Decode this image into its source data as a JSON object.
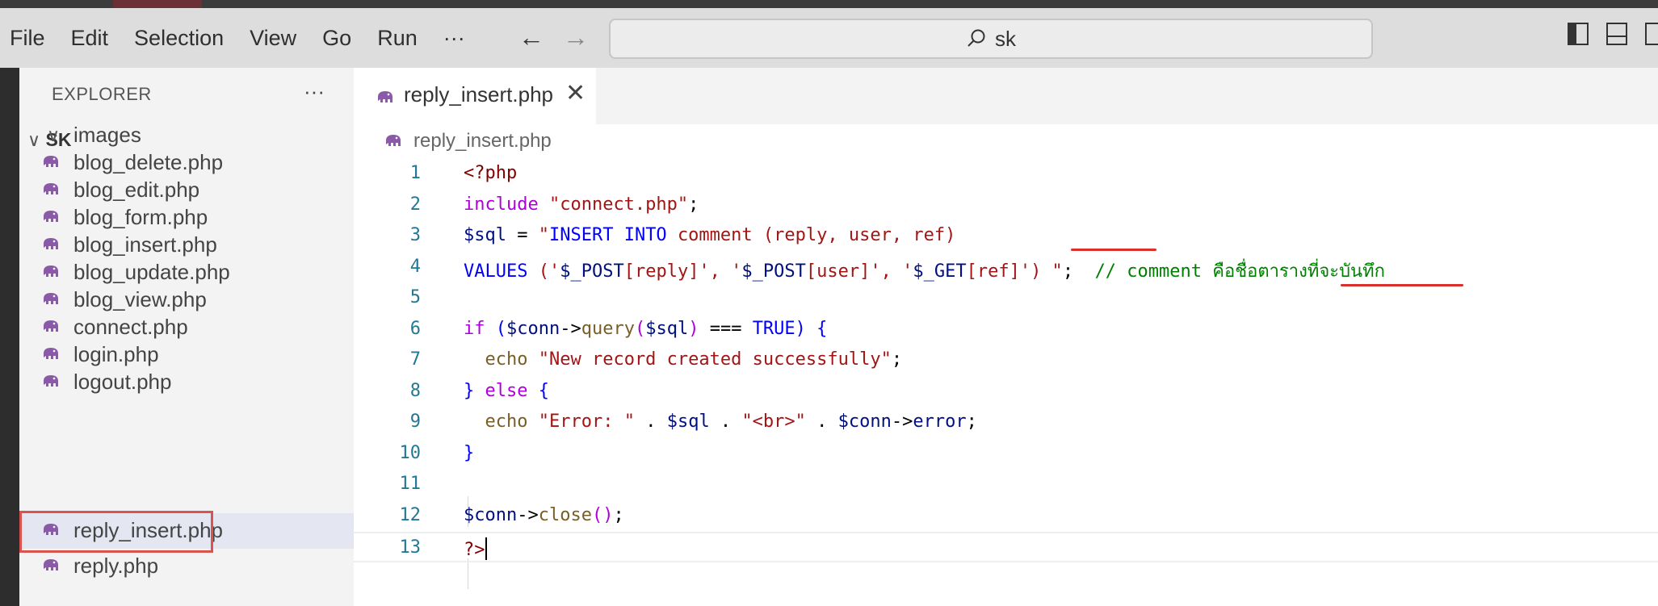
{
  "menu": [
    "File",
    "Edit",
    "Selection",
    "View",
    "Go",
    "Run",
    "···"
  ],
  "search": {
    "value": "sk"
  },
  "explorer": {
    "title": "EXPLORER",
    "more": "···",
    "folder": "SK",
    "items": [
      {
        "label": "images",
        "type": "folder"
      },
      {
        "label": "blog_delete.php",
        "type": "php"
      },
      {
        "label": "blog_edit.php",
        "type": "php"
      },
      {
        "label": "blog_form.php",
        "type": "php"
      },
      {
        "label": "blog_insert.php",
        "type": "php"
      },
      {
        "label": "blog_update.php",
        "type": "php"
      },
      {
        "label": "blog_view.php",
        "type": "php"
      },
      {
        "label": "connect.php",
        "type": "php"
      },
      {
        "label": "login.php",
        "type": "php"
      },
      {
        "label": "logout.php",
        "type": "php"
      },
      {
        "label": "reply_insert.php",
        "type": "php",
        "selected": true
      },
      {
        "label": "reply.php",
        "type": "php"
      }
    ]
  },
  "editor": {
    "tab_label": "reply_insert.php",
    "tab_close": "✕",
    "breadcrumb": "reply_insert.php",
    "line_numbers": [
      "1",
      "2",
      "3",
      "4",
      "5",
      "6",
      "7",
      "8",
      "9",
      "10",
      "11",
      "12",
      "13"
    ],
    "lines": [
      "<?php",
      "include \"connect.php\";",
      "$sql = \"INSERT INTO comment (reply, user, ref)",
      "VALUES ('$_POST[reply]', '$_POST[user]', '$_GET[ref]') \";  // comment คือชื่อตารางที่จะบันทึก",
      "",
      "if ($conn->query($sql) === TRUE) {",
      "  echo \"New record created successfully\";",
      "} else {",
      "  echo \"Error: \" . $sql . \"<br>\" . $conn->error;",
      "}",
      "",
      "$conn->close();",
      "?>"
    ]
  },
  "colors": {
    "keyword_purple": "#af00db",
    "keyword_blue": "#0000ff",
    "string": "#a31515",
    "variable": "#001080",
    "function": "#795e26",
    "comment": "#008000",
    "line_number": "#237893",
    "annotation_red": "#d9302c"
  }
}
